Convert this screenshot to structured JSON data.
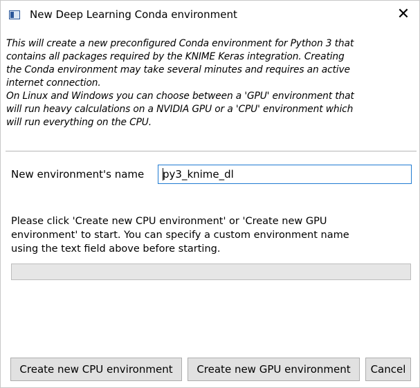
{
  "window": {
    "title": "New Deep Learning Conda environment",
    "close_glyph": "✕",
    "icon": "app-window-icon"
  },
  "description": "This will create a new preconfigured Conda environment for Python 3 that\ncontains all packages required by the KNIME Keras integration. Creating\nthe Conda environment may take several minutes and requires an active\ninternet connection.\nOn Linux and Windows you can choose between a 'GPU' environment that\nwill run heavy calculations on a NVIDIA GPU or a 'CPU' environment which\nwill run everything on the CPU.",
  "form": {
    "name_label": "New environment's name",
    "name_value": "py3_knime_dl"
  },
  "instructions": "Please click 'Create new CPU environment' or 'Create new GPU\nenvironment' to start. You can specify a custom environment name\nusing the text field above before starting.",
  "progress": {
    "value": 0
  },
  "buttons": {
    "create_cpu": "Create new CPU environment",
    "create_gpu": "Create new GPU environment",
    "cancel": "Cancel"
  }
}
